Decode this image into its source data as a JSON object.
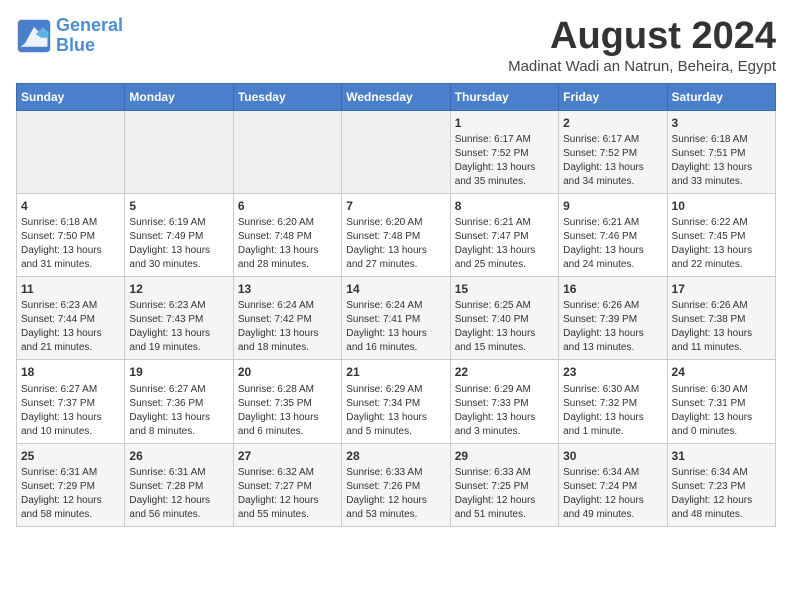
{
  "logo": {
    "text_general": "General",
    "text_blue": "Blue"
  },
  "title": "August 2024",
  "subtitle": "Madinat Wadi an Natrun, Beheira, Egypt",
  "days_of_week": [
    "Sunday",
    "Monday",
    "Tuesday",
    "Wednesday",
    "Thursday",
    "Friday",
    "Saturday"
  ],
  "weeks": [
    [
      {
        "day": "",
        "info": ""
      },
      {
        "day": "",
        "info": ""
      },
      {
        "day": "",
        "info": ""
      },
      {
        "day": "",
        "info": ""
      },
      {
        "day": "1",
        "info": "Sunrise: 6:17 AM\nSunset: 7:52 PM\nDaylight: 13 hours\nand 35 minutes."
      },
      {
        "day": "2",
        "info": "Sunrise: 6:17 AM\nSunset: 7:52 PM\nDaylight: 13 hours\nand 34 minutes."
      },
      {
        "day": "3",
        "info": "Sunrise: 6:18 AM\nSunset: 7:51 PM\nDaylight: 13 hours\nand 33 minutes."
      }
    ],
    [
      {
        "day": "4",
        "info": "Sunrise: 6:18 AM\nSunset: 7:50 PM\nDaylight: 13 hours\nand 31 minutes."
      },
      {
        "day": "5",
        "info": "Sunrise: 6:19 AM\nSunset: 7:49 PM\nDaylight: 13 hours\nand 30 minutes."
      },
      {
        "day": "6",
        "info": "Sunrise: 6:20 AM\nSunset: 7:48 PM\nDaylight: 13 hours\nand 28 minutes."
      },
      {
        "day": "7",
        "info": "Sunrise: 6:20 AM\nSunset: 7:48 PM\nDaylight: 13 hours\nand 27 minutes."
      },
      {
        "day": "8",
        "info": "Sunrise: 6:21 AM\nSunset: 7:47 PM\nDaylight: 13 hours\nand 25 minutes."
      },
      {
        "day": "9",
        "info": "Sunrise: 6:21 AM\nSunset: 7:46 PM\nDaylight: 13 hours\nand 24 minutes."
      },
      {
        "day": "10",
        "info": "Sunrise: 6:22 AM\nSunset: 7:45 PM\nDaylight: 13 hours\nand 22 minutes."
      }
    ],
    [
      {
        "day": "11",
        "info": "Sunrise: 6:23 AM\nSunset: 7:44 PM\nDaylight: 13 hours\nand 21 minutes."
      },
      {
        "day": "12",
        "info": "Sunrise: 6:23 AM\nSunset: 7:43 PM\nDaylight: 13 hours\nand 19 minutes."
      },
      {
        "day": "13",
        "info": "Sunrise: 6:24 AM\nSunset: 7:42 PM\nDaylight: 13 hours\nand 18 minutes."
      },
      {
        "day": "14",
        "info": "Sunrise: 6:24 AM\nSunset: 7:41 PM\nDaylight: 13 hours\nand 16 minutes."
      },
      {
        "day": "15",
        "info": "Sunrise: 6:25 AM\nSunset: 7:40 PM\nDaylight: 13 hours\nand 15 minutes."
      },
      {
        "day": "16",
        "info": "Sunrise: 6:26 AM\nSunset: 7:39 PM\nDaylight: 13 hours\nand 13 minutes."
      },
      {
        "day": "17",
        "info": "Sunrise: 6:26 AM\nSunset: 7:38 PM\nDaylight: 13 hours\nand 11 minutes."
      }
    ],
    [
      {
        "day": "18",
        "info": "Sunrise: 6:27 AM\nSunset: 7:37 PM\nDaylight: 13 hours\nand 10 minutes."
      },
      {
        "day": "19",
        "info": "Sunrise: 6:27 AM\nSunset: 7:36 PM\nDaylight: 13 hours\nand 8 minutes."
      },
      {
        "day": "20",
        "info": "Sunrise: 6:28 AM\nSunset: 7:35 PM\nDaylight: 13 hours\nand 6 minutes."
      },
      {
        "day": "21",
        "info": "Sunrise: 6:29 AM\nSunset: 7:34 PM\nDaylight: 13 hours\nand 5 minutes."
      },
      {
        "day": "22",
        "info": "Sunrise: 6:29 AM\nSunset: 7:33 PM\nDaylight: 13 hours\nand 3 minutes."
      },
      {
        "day": "23",
        "info": "Sunrise: 6:30 AM\nSunset: 7:32 PM\nDaylight: 13 hours\nand 1 minute."
      },
      {
        "day": "24",
        "info": "Sunrise: 6:30 AM\nSunset: 7:31 PM\nDaylight: 13 hours\nand 0 minutes."
      }
    ],
    [
      {
        "day": "25",
        "info": "Sunrise: 6:31 AM\nSunset: 7:29 PM\nDaylight: 12 hours\nand 58 minutes."
      },
      {
        "day": "26",
        "info": "Sunrise: 6:31 AM\nSunset: 7:28 PM\nDaylight: 12 hours\nand 56 minutes."
      },
      {
        "day": "27",
        "info": "Sunrise: 6:32 AM\nSunset: 7:27 PM\nDaylight: 12 hours\nand 55 minutes."
      },
      {
        "day": "28",
        "info": "Sunrise: 6:33 AM\nSunset: 7:26 PM\nDaylight: 12 hours\nand 53 minutes."
      },
      {
        "day": "29",
        "info": "Sunrise: 6:33 AM\nSunset: 7:25 PM\nDaylight: 12 hours\nand 51 minutes."
      },
      {
        "day": "30",
        "info": "Sunrise: 6:34 AM\nSunset: 7:24 PM\nDaylight: 12 hours\nand 49 minutes."
      },
      {
        "day": "31",
        "info": "Sunrise: 6:34 AM\nSunset: 7:23 PM\nDaylight: 12 hours\nand 48 minutes."
      }
    ]
  ]
}
